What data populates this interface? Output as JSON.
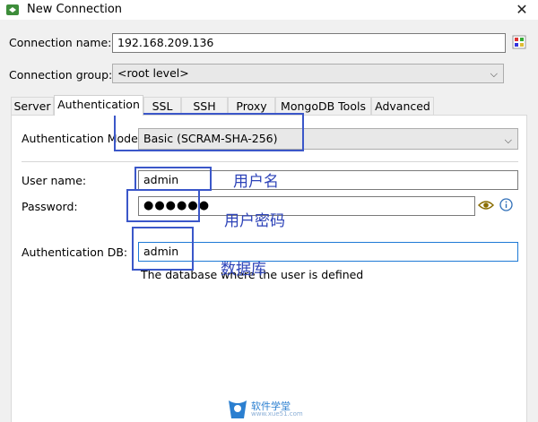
{
  "window": {
    "title": "New Connection"
  },
  "connection_name": {
    "label": "Connection name:",
    "value": "192.168.209.136"
  },
  "connection_group": {
    "label": "Connection group:",
    "value": "<root level>"
  },
  "tabs": [
    {
      "label": "Server"
    },
    {
      "label": "Authentication"
    },
    {
      "label": "SSL"
    },
    {
      "label": "SSH"
    },
    {
      "label": "Proxy"
    },
    {
      "label": "MongoDB Tools"
    },
    {
      "label": "Advanced"
    }
  ],
  "auth": {
    "mode_label": "Authentication Mode:",
    "mode_value": "Basic (SCRAM-SHA-256)",
    "user_label": "User name:",
    "user_value": "admin",
    "password_label": "Password:",
    "password_value": "●●●●●●",
    "db_label": "Authentication DB:",
    "db_value": "admin",
    "db_hint": "The database where the user is defined"
  },
  "annotations": {
    "user": "用户名",
    "password": "用户密码",
    "db": "数据库"
  },
  "watermark": {
    "text": "软件学堂",
    "url": "www.xue51.com"
  },
  "colors": {
    "annotation_blue": "#3b57c9",
    "active_input_border": "#1e7ad6"
  }
}
